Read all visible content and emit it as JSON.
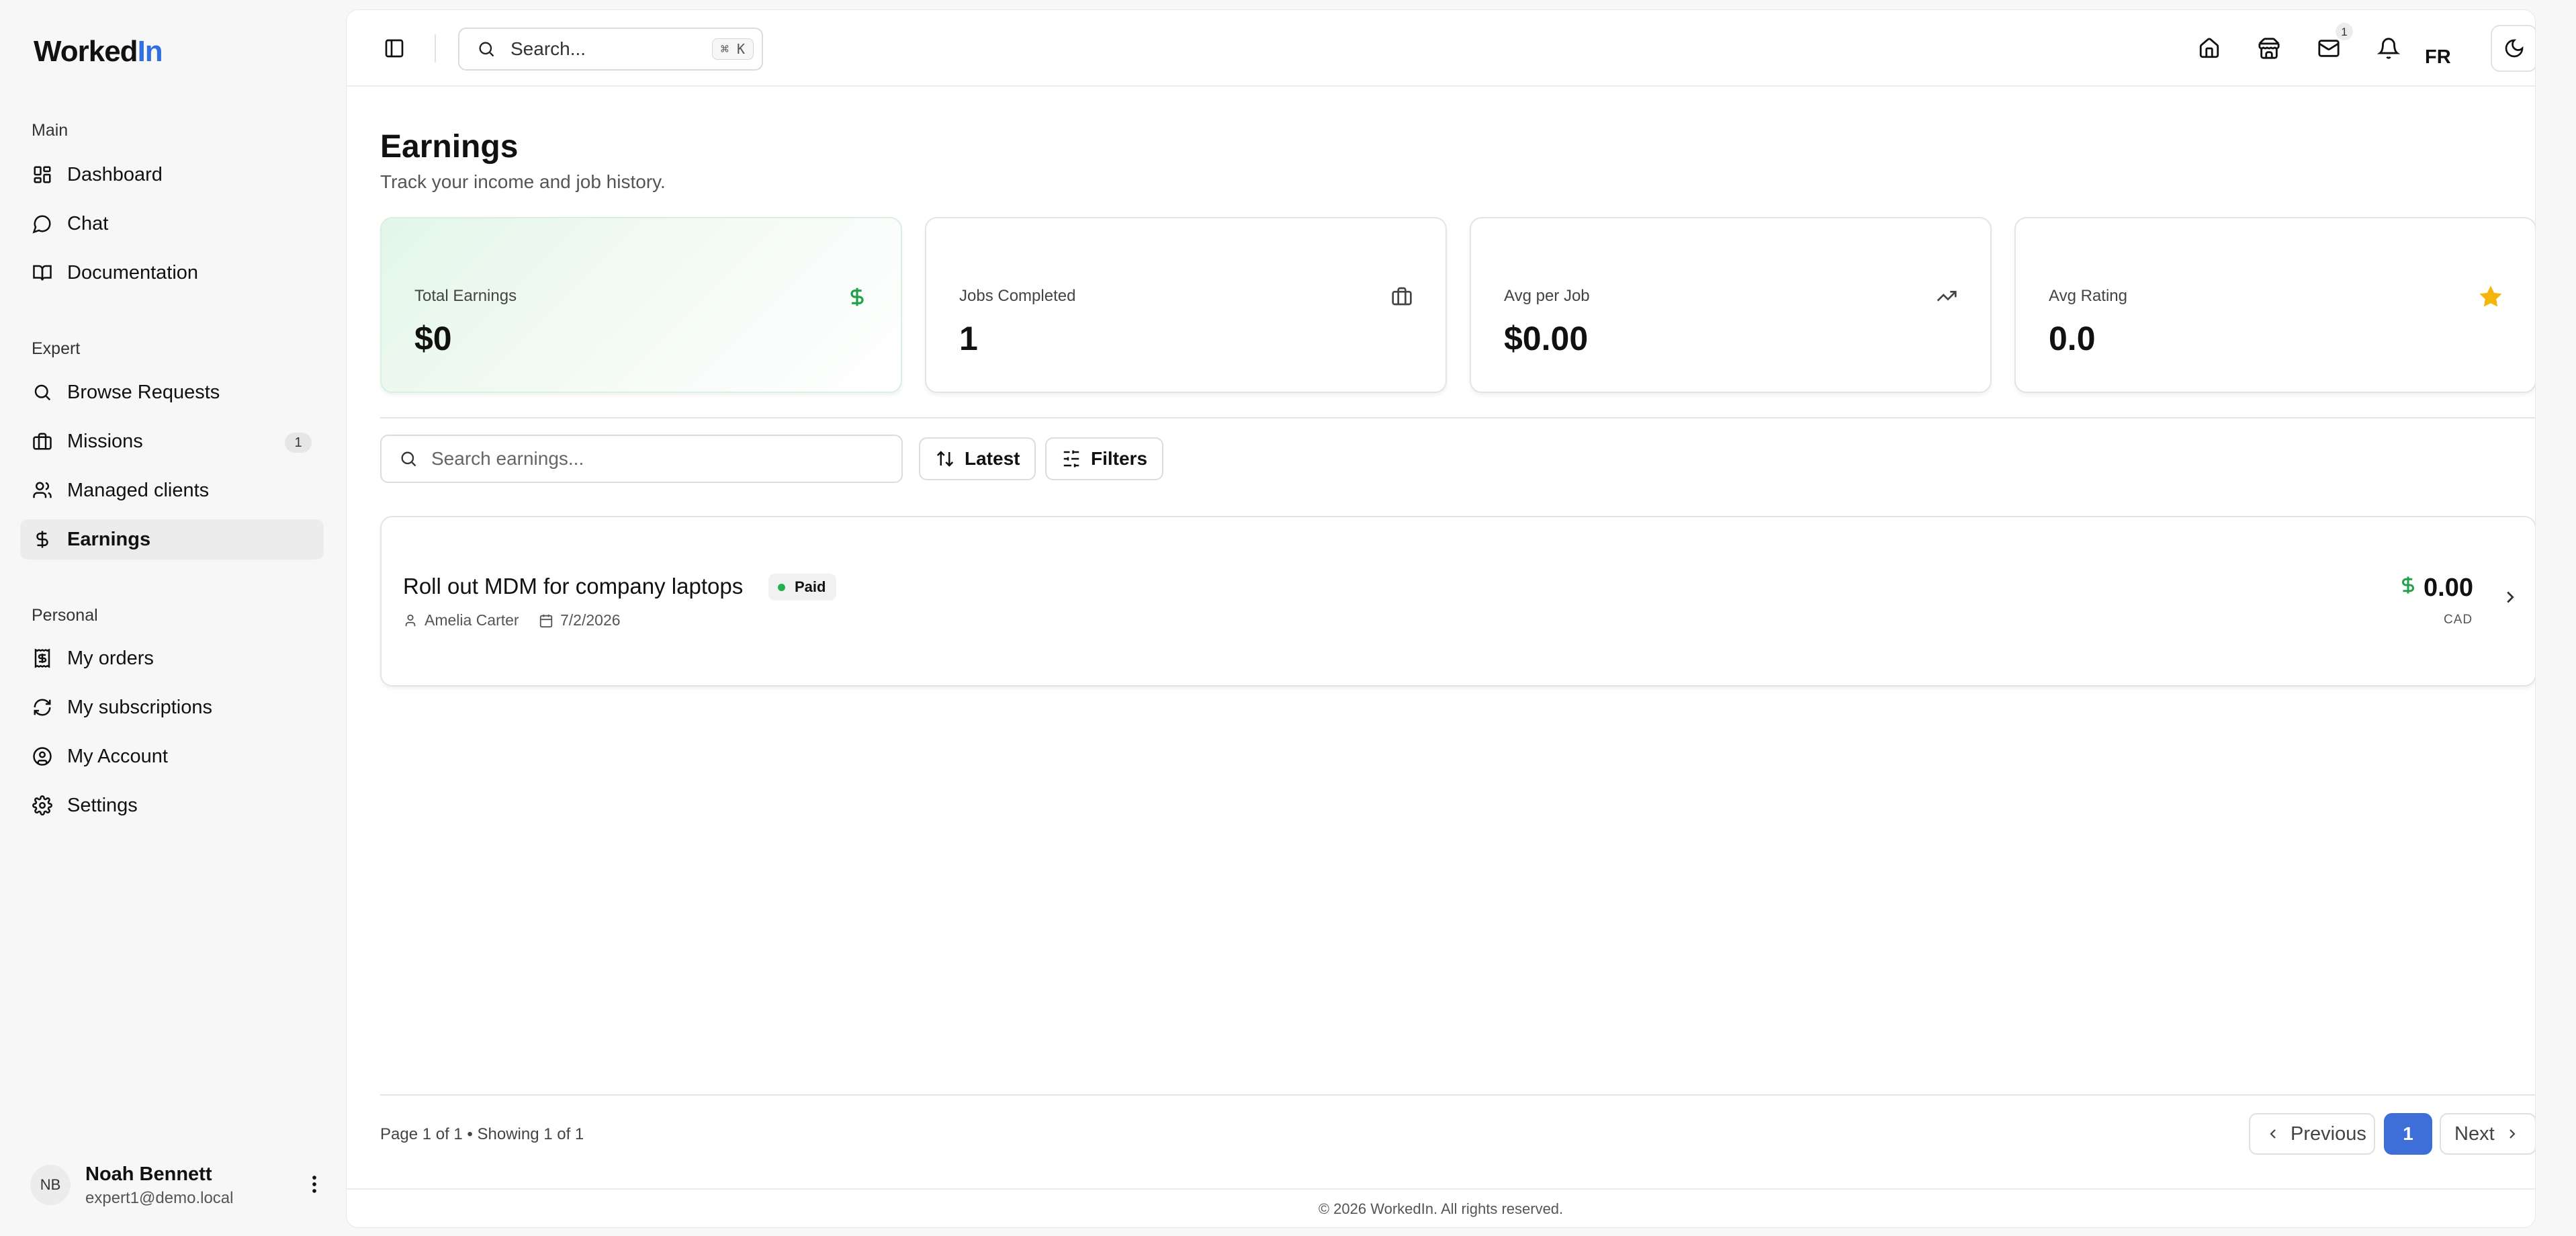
{
  "app": {
    "logo_main": "Worked",
    "logo_accent": "In",
    "brand_color": "#2f6fdf"
  },
  "sidebar": {
    "sections": {
      "main": "Main",
      "expert": "Expert",
      "personal": "Personal"
    },
    "items": [
      {
        "label": "Dashboard",
        "icon": "dashboard-icon"
      },
      {
        "label": "Chat",
        "icon": "chat-icon"
      },
      {
        "label": "Documentation",
        "icon": "book-icon"
      },
      {
        "label": "Browse Requests",
        "icon": "search-icon"
      },
      {
        "label": "Missions",
        "icon": "briefcase-icon",
        "badge": "1"
      },
      {
        "label": "Managed clients",
        "icon": "users-icon"
      },
      {
        "label": "Earnings",
        "icon": "dollar-icon",
        "active": true
      },
      {
        "label": "My orders",
        "icon": "receipt-icon"
      },
      {
        "label": "My subscriptions",
        "icon": "refresh-icon"
      },
      {
        "label": "My Account",
        "icon": "user-circle-icon"
      },
      {
        "label": "Settings",
        "icon": "gear-icon"
      }
    ],
    "user": {
      "initials": "NB",
      "name": "Noah Bennett",
      "email": "expert1@demo.local"
    }
  },
  "topbar": {
    "search_placeholder": "Search...",
    "shortcut": "⌘ K",
    "mail_badge": "1",
    "language": "FR"
  },
  "page": {
    "title": "Earnings",
    "subtitle": "Track your income and job history."
  },
  "stats": [
    {
      "label": "Total Earnings",
      "value": "$0",
      "icon": "dollar-icon"
    },
    {
      "label": "Jobs Completed",
      "value": "1",
      "icon": "briefcase-icon"
    },
    {
      "label": "Avg per Job",
      "value": "$0.00",
      "icon": "trending-up-icon"
    },
    {
      "label": "Avg Rating",
      "value": "0.0",
      "icon": "star-icon"
    }
  ],
  "filters": {
    "search_placeholder": "Search earnings...",
    "sort_label": "Latest",
    "filters_label": "Filters"
  },
  "earnings": [
    {
      "title": "Roll out MDM for company laptops",
      "status": "Paid",
      "client": "Amelia Carter",
      "date": "7/2/2026",
      "amount": "0.00",
      "currency": "CAD"
    }
  ],
  "pagination": {
    "info": "Page 1 of 1 • Showing 1 of 1",
    "previous": "Previous",
    "current": "1",
    "next": "Next"
  },
  "footer": {
    "text": "© 2026 WorkedIn. All rights reserved."
  },
  "colors": {
    "green": "#22a14a",
    "star": "#f5b50a",
    "active_page": "#3e6fd9"
  }
}
